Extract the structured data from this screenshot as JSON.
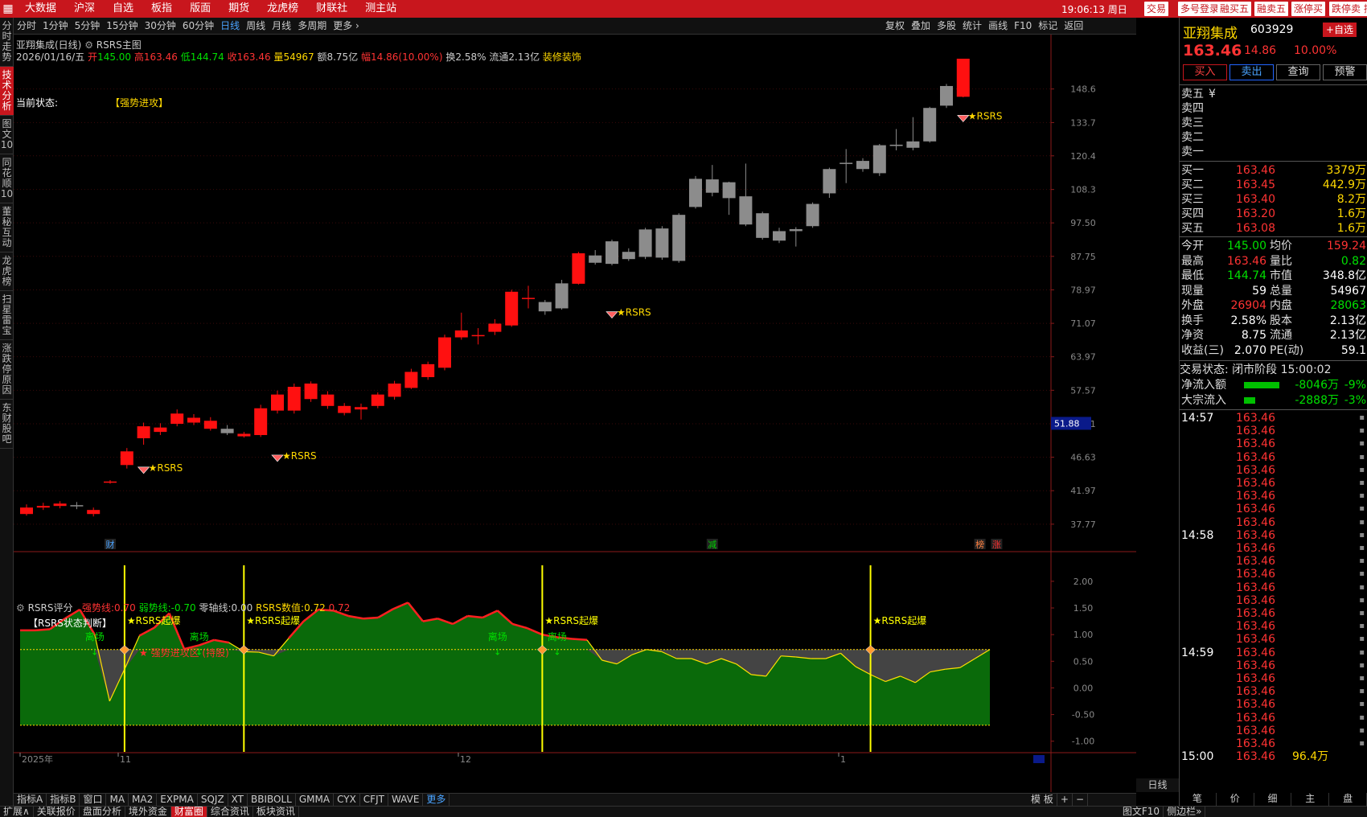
{
  "topbar": {
    "menu": [
      "大数据",
      "沪深",
      "自选",
      "板指",
      "版面",
      "期货",
      "龙虎榜",
      "财联社",
      "测主站"
    ],
    "clock": "19:06:13 周日",
    "buttons": [
      "交易",
      "多号登录",
      "融买五",
      "融卖五",
      "涨停买",
      "跌停卖",
      "撤"
    ]
  },
  "leftnav": [
    "分时走势",
    "技术分析",
    "图文10",
    "同花顺10",
    "董秘互动",
    "龙虎榜",
    "扫星雷宝",
    "涨跌停原因",
    "东财股吧"
  ],
  "periodbar": {
    "items": [
      "分时",
      "1分钟",
      "5分钟",
      "15分钟",
      "30分钟",
      "60分钟",
      "日线",
      "周线",
      "月线",
      "多周期",
      "更多 ›"
    ],
    "active": "日线",
    "right": [
      "复权",
      "叠加",
      "多股",
      "统计",
      "画线",
      "F10",
      "标记",
      "返回"
    ]
  },
  "chart": {
    "title": "亚翔集成(日线)",
    "indicator": "RSRS主图",
    "info": {
      "date": "2026/01/16/五",
      "open_label": "开",
      "open": "145.00",
      "high_label": "高",
      "high": "163.46",
      "low_label": "低",
      "low": "144.74",
      "close_label": "收",
      "close": "163.46",
      "vol_label": "量",
      "vol": "54967",
      "amt_label": "额",
      "amt": "8.75亿",
      "amp_label": "幅",
      "amp": "14.86(10.00%)",
      "turn_label": "换",
      "turn": "2.58%",
      "flow_label": "流通",
      "flow": "2.13亿",
      "industry": "装修装饰"
    },
    "status_label": "当前状态:",
    "status_value": "【强势进攻】",
    "price_axis": [
      "148.6",
      "133.7",
      "120.4",
      "108.3",
      "97.50",
      "87.75",
      "78.97",
      "71.07",
      "63.97",
      "57.57",
      "51.81",
      "46.63",
      "41.97",
      "37.77"
    ],
    "current_price_tag": "51.88",
    "signal_label": "RSRS",
    "markers": [
      "财",
      "减",
      "榜",
      "涨"
    ],
    "date_axis": [
      "2025年",
      "11",
      "12",
      "1"
    ]
  },
  "sub": {
    "title": "RSRS评分",
    "strong_label": "强势线:",
    "strong": "0.70",
    "weak_label": "弱势线:",
    "weak": "-0.70",
    "zero_label": "零轴线:",
    "zero": "0.00",
    "value_label": "RSRS数值:",
    "value": "0.72",
    "extra": "0.72",
    "subtitle": "【RSRS状态判断】",
    "zone_label": "★ 强势进攻区 (持股)",
    "burst_label": "★RSRS起爆",
    "exit_label": "离场",
    "axis": [
      "2.00",
      "1.50",
      "1.00",
      "0.50",
      "0.00",
      "-0.50",
      "-1.00"
    ]
  },
  "bottomtabs": [
    "指标A",
    "指标B",
    "窗口",
    "MA",
    "MA2",
    "EXPMA",
    "SQJZ",
    "XT",
    "BBIBOLL",
    "GMMA",
    "CYX",
    "CFJT",
    "WAVE",
    "更多"
  ],
  "bottom_right": [
    "模 板",
    "+",
    "−"
  ],
  "period_label": "日线",
  "statusbar": [
    "扩展∧",
    "关联报价",
    "盘面分析",
    "境外资金",
    "财富圈",
    "综合资讯",
    "板块资讯",
    "图文F10",
    "侧边栏»"
  ],
  "quote": {
    "name": "亚翔集成",
    "code": "603929",
    "add": "+自选",
    "price": "163.46",
    "change": "14.86",
    "pct": "10.00%",
    "buttons": [
      "买入",
      "卖出",
      "查询",
      "预警"
    ],
    "asks": [
      {
        "label": "卖五",
        "price": "",
        "vol": ""
      },
      {
        "label": "卖四",
        "price": "",
        "vol": ""
      },
      {
        "label": "卖三",
        "price": "",
        "vol": ""
      },
      {
        "label": "卖二",
        "price": "",
        "vol": ""
      },
      {
        "label": "卖一",
        "price": "",
        "vol": ""
      }
    ],
    "bids": [
      {
        "label": "买一",
        "price": "163.46",
        "vol": "3379万"
      },
      {
        "label": "买二",
        "price": "163.45",
        "vol": "442.9万"
      },
      {
        "label": "买三",
        "price": "163.40",
        "vol": "8.2万"
      },
      {
        "label": "买四",
        "price": "163.20",
        "vol": "1.6万"
      },
      {
        "label": "买五",
        "price": "163.08",
        "vol": "1.6万"
      }
    ],
    "stats": [
      {
        "l1": "今开",
        "v1": "145.00",
        "c1": "green",
        "l2": "均价",
        "v2": "159.24",
        "c2": "red"
      },
      {
        "l1": "最高",
        "v1": "163.46",
        "c1": "red",
        "l2": "量比",
        "v2": "0.82",
        "c2": "green"
      },
      {
        "l1": "最低",
        "v1": "144.74",
        "c1": "green",
        "l2": "市值",
        "v2": "348.8亿",
        "c2": "wht"
      },
      {
        "l1": "现量",
        "v1": "59",
        "c1": "wht",
        "l2": "总量",
        "v2": "54967",
        "c2": "wht"
      },
      {
        "l1": "外盘",
        "v1": "26904",
        "c1": "red",
        "l2": "内盘",
        "v2": "28063",
        "c2": "green"
      },
      {
        "l1": "换手",
        "v1": "2.58%",
        "c1": "wht",
        "l2": "股本",
        "v2": "2.13亿",
        "c2": "wht"
      },
      {
        "l1": "净资",
        "v1": "8.75",
        "c1": "wht",
        "l2": "流通",
        "v2": "2.13亿",
        "c2": "wht"
      },
      {
        "l1": "收益(三)",
        "v1": "2.070",
        "c1": "wht",
        "l2": "PE(动)",
        "v2": "59.1",
        "c2": "wht"
      }
    ],
    "trade_state": "交易状态: 闭市阶段 15:00:02",
    "netflow_label": "净流入额",
    "netflow": "-8046万",
    "netflow_pct": "-9%",
    "block_label": "大宗流入",
    "block": "-2888万",
    "block_pct": "-3%",
    "ticks": [
      {
        "time": "14:57",
        "price": "163.46"
      },
      {
        "time": "",
        "price": "163.46"
      },
      {
        "time": "",
        "price": "163.46"
      },
      {
        "time": "",
        "price": "163.46"
      },
      {
        "time": "",
        "price": "163.46"
      },
      {
        "time": "",
        "price": "163.46"
      },
      {
        "time": "",
        "price": "163.46"
      },
      {
        "time": "",
        "price": "163.46"
      },
      {
        "time": "",
        "price": "163.46"
      },
      {
        "time": "14:58",
        "price": "163.46"
      },
      {
        "time": "",
        "price": "163.46"
      },
      {
        "time": "",
        "price": "163.46"
      },
      {
        "time": "",
        "price": "163.46"
      },
      {
        "time": "",
        "price": "163.46"
      },
      {
        "time": "",
        "price": "163.46"
      },
      {
        "time": "",
        "price": "163.46"
      },
      {
        "time": "",
        "price": "163.46"
      },
      {
        "time": "",
        "price": "163.46"
      },
      {
        "time": "14:59",
        "price": "163.46"
      },
      {
        "time": "",
        "price": "163.46"
      },
      {
        "time": "",
        "price": "163.46"
      },
      {
        "time": "",
        "price": "163.46"
      },
      {
        "time": "",
        "price": "163.46"
      },
      {
        "time": "",
        "price": "163.46"
      },
      {
        "time": "",
        "price": "163.46"
      },
      {
        "time": "",
        "price": "163.46"
      }
    ],
    "last_tick": {
      "time": "15:00",
      "price": "163.46",
      "vol": "96.4万"
    },
    "tabs": [
      "笔",
      "价",
      "细",
      "主",
      "盘"
    ]
  },
  "candles": [
    {
      "o": 39.0,
      "c": 39.8,
      "h": 40.2,
      "l": 38.8
    },
    {
      "o": 39.8,
      "c": 40.0,
      "h": 40.4,
      "l": 39.5
    },
    {
      "o": 40.0,
      "c": 40.3,
      "h": 40.6,
      "l": 39.7
    },
    {
      "o": 40.1,
      "c": 40.0,
      "h": 40.5,
      "l": 39.6
    },
    {
      "o": 39.0,
      "c": 39.5,
      "h": 39.8,
      "l": 38.7
    },
    {
      "o": 43.1,
      "c": 43.2,
      "h": 43.4,
      "l": 42.9
    },
    {
      "o": 45.5,
      "c": 47.5,
      "h": 48.0,
      "l": 45.0
    },
    {
      "o": 49.5,
      "c": 51.4,
      "h": 52.0,
      "l": 48.5
    },
    {
      "o": 50.5,
      "c": 51.2,
      "h": 51.9,
      "l": 50.0
    },
    {
      "o": 51.8,
      "c": 53.5,
      "h": 54.2,
      "l": 51.4
    },
    {
      "o": 52.0,
      "c": 52.8,
      "h": 53.4,
      "l": 51.6
    },
    {
      "o": 51.0,
      "c": 52.3,
      "h": 52.9,
      "l": 50.7
    },
    {
      "o": 51.0,
      "c": 50.3,
      "h": 51.6,
      "l": 50.0
    },
    {
      "o": 49.8,
      "c": 50.2,
      "h": 50.5,
      "l": 49.6
    },
    {
      "o": 50.0,
      "c": 54.4,
      "h": 55.0,
      "l": 49.7
    },
    {
      "o": 54.0,
      "c": 56.8,
      "h": 57.5,
      "l": 53.5
    },
    {
      "o": 54.0,
      "c": 58.2,
      "h": 58.8,
      "l": 53.5
    },
    {
      "o": 56.0,
      "c": 58.8,
      "h": 59.2,
      "l": 55.5
    },
    {
      "o": 54.8,
      "c": 56.8,
      "h": 57.4,
      "l": 54.3
    },
    {
      "o": 53.6,
      "c": 54.8,
      "h": 55.3,
      "l": 53.2
    },
    {
      "o": 54.2,
      "c": 54.6,
      "h": 55.2,
      "l": 52.5
    },
    {
      "o": 54.8,
      "c": 56.8,
      "h": 57.2,
      "l": 54.4
    },
    {
      "o": 56.4,
      "c": 58.8,
      "h": 59.3,
      "l": 55.9
    },
    {
      "o": 58.0,
      "c": 61.0,
      "h": 61.6,
      "l": 57.8
    },
    {
      "o": 60.0,
      "c": 62.5,
      "h": 63.0,
      "l": 59.5
    },
    {
      "o": 61.8,
      "c": 68.0,
      "h": 68.6,
      "l": 61.3
    },
    {
      "o": 68.0,
      "c": 69.5,
      "h": 73.5,
      "l": 67.5
    },
    {
      "o": 68.4,
      "c": 68.5,
      "h": 70.0,
      "l": 66.5
    },
    {
      "o": 69.2,
      "c": 71.0,
      "h": 72.0,
      "l": 68.5
    },
    {
      "o": 70.6,
      "c": 78.5,
      "h": 79.0,
      "l": 70.3
    },
    {
      "o": 76.8,
      "c": 77.0,
      "h": 80.0,
      "l": 74.5
    },
    {
      "o": 76.0,
      "c": 73.8,
      "h": 76.5,
      "l": 73.0
    },
    {
      "o": 80.6,
      "c": 74.5,
      "h": 81.5,
      "l": 74.2
    },
    {
      "o": 80.5,
      "c": 88.6,
      "h": 89.0,
      "l": 80.3
    },
    {
      "o": 88.0,
      "c": 86.0,
      "h": 89.5,
      "l": 85.5
    },
    {
      "o": 92.0,
      "c": 85.7,
      "h": 92.5,
      "l": 85.3
    },
    {
      "o": 89.0,
      "c": 87.0,
      "h": 90.0,
      "l": 86.5
    },
    {
      "o": 95.5,
      "c": 87.6,
      "h": 96.0,
      "l": 87.0
    },
    {
      "o": 95.8,
      "c": 87.4,
      "h": 96.5,
      "l": 86.8
    },
    {
      "o": 100.0,
      "c": 86.5,
      "h": 100.5,
      "l": 86.0
    },
    {
      "o": 112.0,
      "c": 102.5,
      "h": 113.0,
      "l": 102.0
    },
    {
      "o": 111.8,
      "c": 107.2,
      "h": 117.0,
      "l": 106.0
    },
    {
      "o": 110.8,
      "c": 105.4,
      "h": 111.0,
      "l": 100.0
    },
    {
      "o": 106.0,
      "c": 97.0,
      "h": 117.5,
      "l": 96.5
    },
    {
      "o": 100.5,
      "c": 93.0,
      "h": 101.0,
      "l": 92.5
    },
    {
      "o": 95.0,
      "c": 92.2,
      "h": 96.0,
      "l": 91.5
    },
    {
      "o": 95.6,
      "c": 95.0,
      "h": 96.2,
      "l": 90.5
    },
    {
      "o": 103.5,
      "c": 96.5,
      "h": 104.0,
      "l": 96.0
    },
    {
      "o": 115.5,
      "c": 107.0,
      "h": 116.0,
      "l": 105.5
    },
    {
      "o": 117.8,
      "c": 117.5,
      "h": 123.0,
      "l": 110.5
    },
    {
      "o": 118.5,
      "c": 115.5,
      "h": 119.5,
      "l": 114.5
    },
    {
      "o": 124.5,
      "c": 114.0,
      "h": 125.0,
      "l": 113.0
    },
    {
      "o": 124.7,
      "c": 124.2,
      "h": 131.0,
      "l": 122.5
    },
    {
      "o": 126.0,
      "c": 123.5,
      "h": 136.0,
      "l": 122.5
    },
    {
      "o": 140.0,
      "c": 126.0,
      "h": 140.5,
      "l": 125.5
    },
    {
      "o": 150.0,
      "c": 141.0,
      "h": 151.0,
      "l": 140.0
    },
    {
      "o": 145.0,
      "c": 163.46,
      "h": 163.46,
      "l": 144.74
    }
  ],
  "rsrs_series": [
    1.08,
    1.08,
    1.1,
    1.3,
    1.47,
    1.0,
    -0.25,
    0.35,
    0.98,
    1.13,
    1.4,
    0.73,
    0.8,
    0.9,
    0.85,
    0.68,
    0.67,
    0.6,
    0.93,
    1.25,
    1.47,
    1.45,
    1.35,
    1.3,
    1.32,
    1.48,
    1.6,
    1.25,
    1.3,
    1.2,
    1.35,
    1.32,
    1.45,
    1.2,
    1.12,
    1.0,
    0.95,
    0.92,
    0.9,
    0.52,
    0.45,
    0.62,
    0.72,
    0.68,
    0.55,
    0.55,
    0.45,
    0.55,
    0.45,
    0.25,
    0.22,
    0.6,
    0.58,
    0.55,
    0.55,
    0.65,
    0.4,
    0.25,
    0.12,
    0.22,
    0.1,
    0.3,
    0.35,
    0.38,
    0.55,
    0.72
  ]
}
